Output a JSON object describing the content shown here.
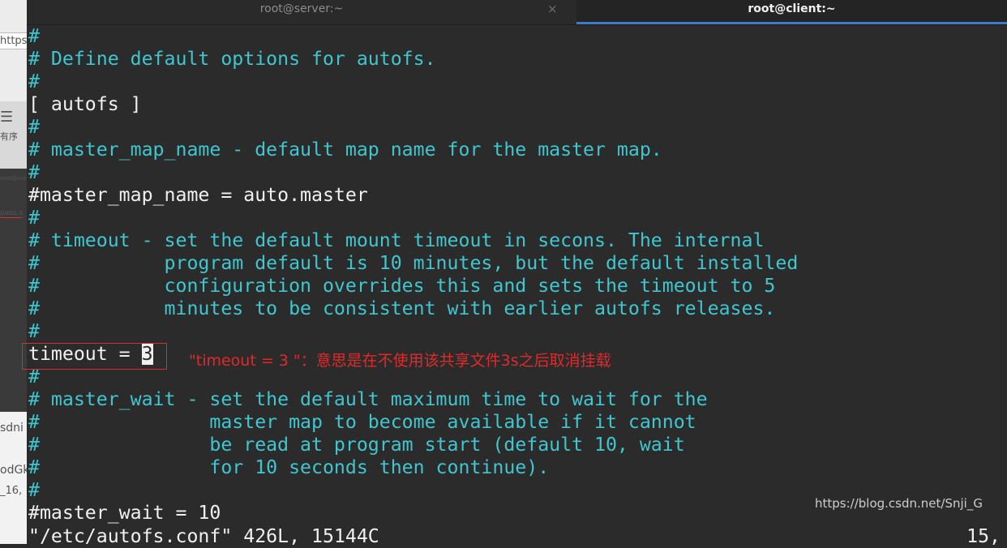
{
  "background_fragments": {
    "url_prefix": "https",
    "list_icon": "☰",
    "list_label": "有序",
    "terminal_thumb_title": "root@client:",
    "thumb_text": "pass,s",
    "frag_sdni": "sdni",
    "frag_odgk": "odGk",
    "frag_16": "_16,"
  },
  "tabs": {
    "server": {
      "label": "root@server:~",
      "close": "×"
    },
    "client": {
      "label": "root@client:~"
    }
  },
  "editor": {
    "lines": [
      "#",
      "# Define default options for autofs.",
      "#",
      "[ autofs ]",
      "#",
      "# master_map_name - default map name for the master map.",
      "#",
      "#master_map_name = auto.master",
      "#",
      "# timeout - set the default mount timeout in secons. The internal",
      "#           program default is 10 minutes, but the default installed",
      "#           configuration overrides this and sets the timeout to 5",
      "#           minutes to be consistent with earlier autofs releases.",
      "#",
      "",
      "#",
      "# master_wait - set the default maximum time to wait for the",
      "#               master map to become available if it cannot",
      "#               be read at program start (default 10, wait",
      "#               for 10 seconds then continue).",
      "#",
      "#master_wait = 10"
    ],
    "timeout_line_prefix": "timeout = ",
    "timeout_value": "3",
    "status_line": "\"/etc/autofs.conf\" 426L, 15144C",
    "cursor_position": "15,"
  },
  "annotation": {
    "text": "\"timeout = 3 \"：意思是在不使用该共享文件3s之后取消挂载",
    "color": "#e02a2a"
  },
  "watermark": "https://blog.csdn.net/Snji_G",
  "colors": {
    "comment": "#3fc6cf",
    "code": "#f0f0f0",
    "background": "#2b2b2b",
    "tab_active_underline": "#3d7bd1"
  }
}
